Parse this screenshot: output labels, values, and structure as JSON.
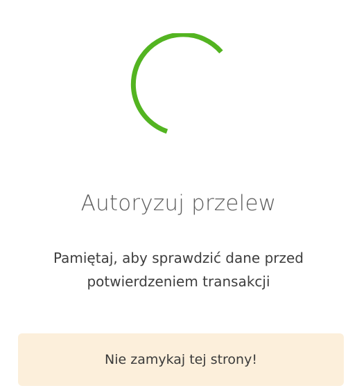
{
  "spinner": {
    "icon": "loading-spinner-icon",
    "color": "#53b421"
  },
  "auth": {
    "title": "Autoryzuj przelew",
    "message_line1": "Pamiętaj, aby sprawdzić dane przed",
    "message_line2": "potwierdzeniem transakcji"
  },
  "warning": {
    "text": "Nie zamykaj tej strony!",
    "background": "#fcefdb"
  }
}
